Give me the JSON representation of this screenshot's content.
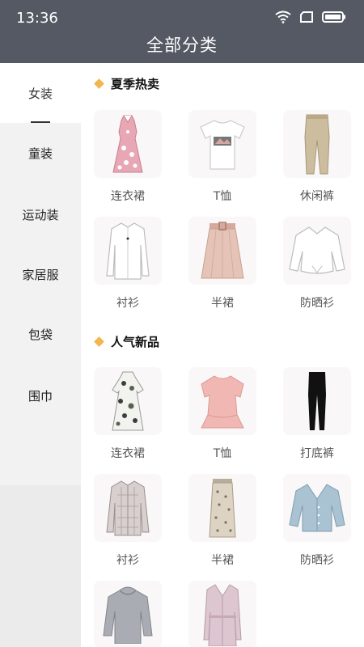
{
  "status_bar": {
    "time": "13:36"
  },
  "header": {
    "title": "全部分类"
  },
  "sidebar": {
    "items": [
      {
        "label": "女装",
        "active": true
      },
      {
        "label": "童装"
      },
      {
        "label": "运动装"
      },
      {
        "label": "家居服"
      },
      {
        "label": "包袋"
      },
      {
        "label": "围巾"
      }
    ]
  },
  "sections": [
    {
      "title": "夏季热卖",
      "items": [
        {
          "label": "连衣裙",
          "icon": "floral-dress-icon"
        },
        {
          "label": "T恤",
          "icon": "tshirt-icon"
        },
        {
          "label": "休闲裤",
          "icon": "trousers-icon"
        },
        {
          "label": "衬衫",
          "icon": "shirt-icon"
        },
        {
          "label": "半裙",
          "icon": "skirt-icon"
        },
        {
          "label": "防晒衫",
          "icon": "sun-shirt-icon"
        }
      ]
    },
    {
      "title": "人气新品",
      "items": [
        {
          "label": "连衣裙",
          "icon": "print-dress-icon"
        },
        {
          "label": "T恤",
          "icon": "pink-top-icon"
        },
        {
          "label": "打底裤",
          "icon": "leggings-icon"
        },
        {
          "label": "衬衫",
          "icon": "plaid-shirt-icon"
        },
        {
          "label": "半裙",
          "icon": "print-skirt-icon"
        },
        {
          "label": "防晒衫",
          "icon": "cardigan-icon"
        },
        {
          "label": "",
          "icon": "sweater-icon"
        },
        {
          "label": "",
          "icon": "coat-icon"
        }
      ]
    }
  ],
  "colors": {
    "header_bg": "#545963",
    "accent": "#f2b650"
  }
}
